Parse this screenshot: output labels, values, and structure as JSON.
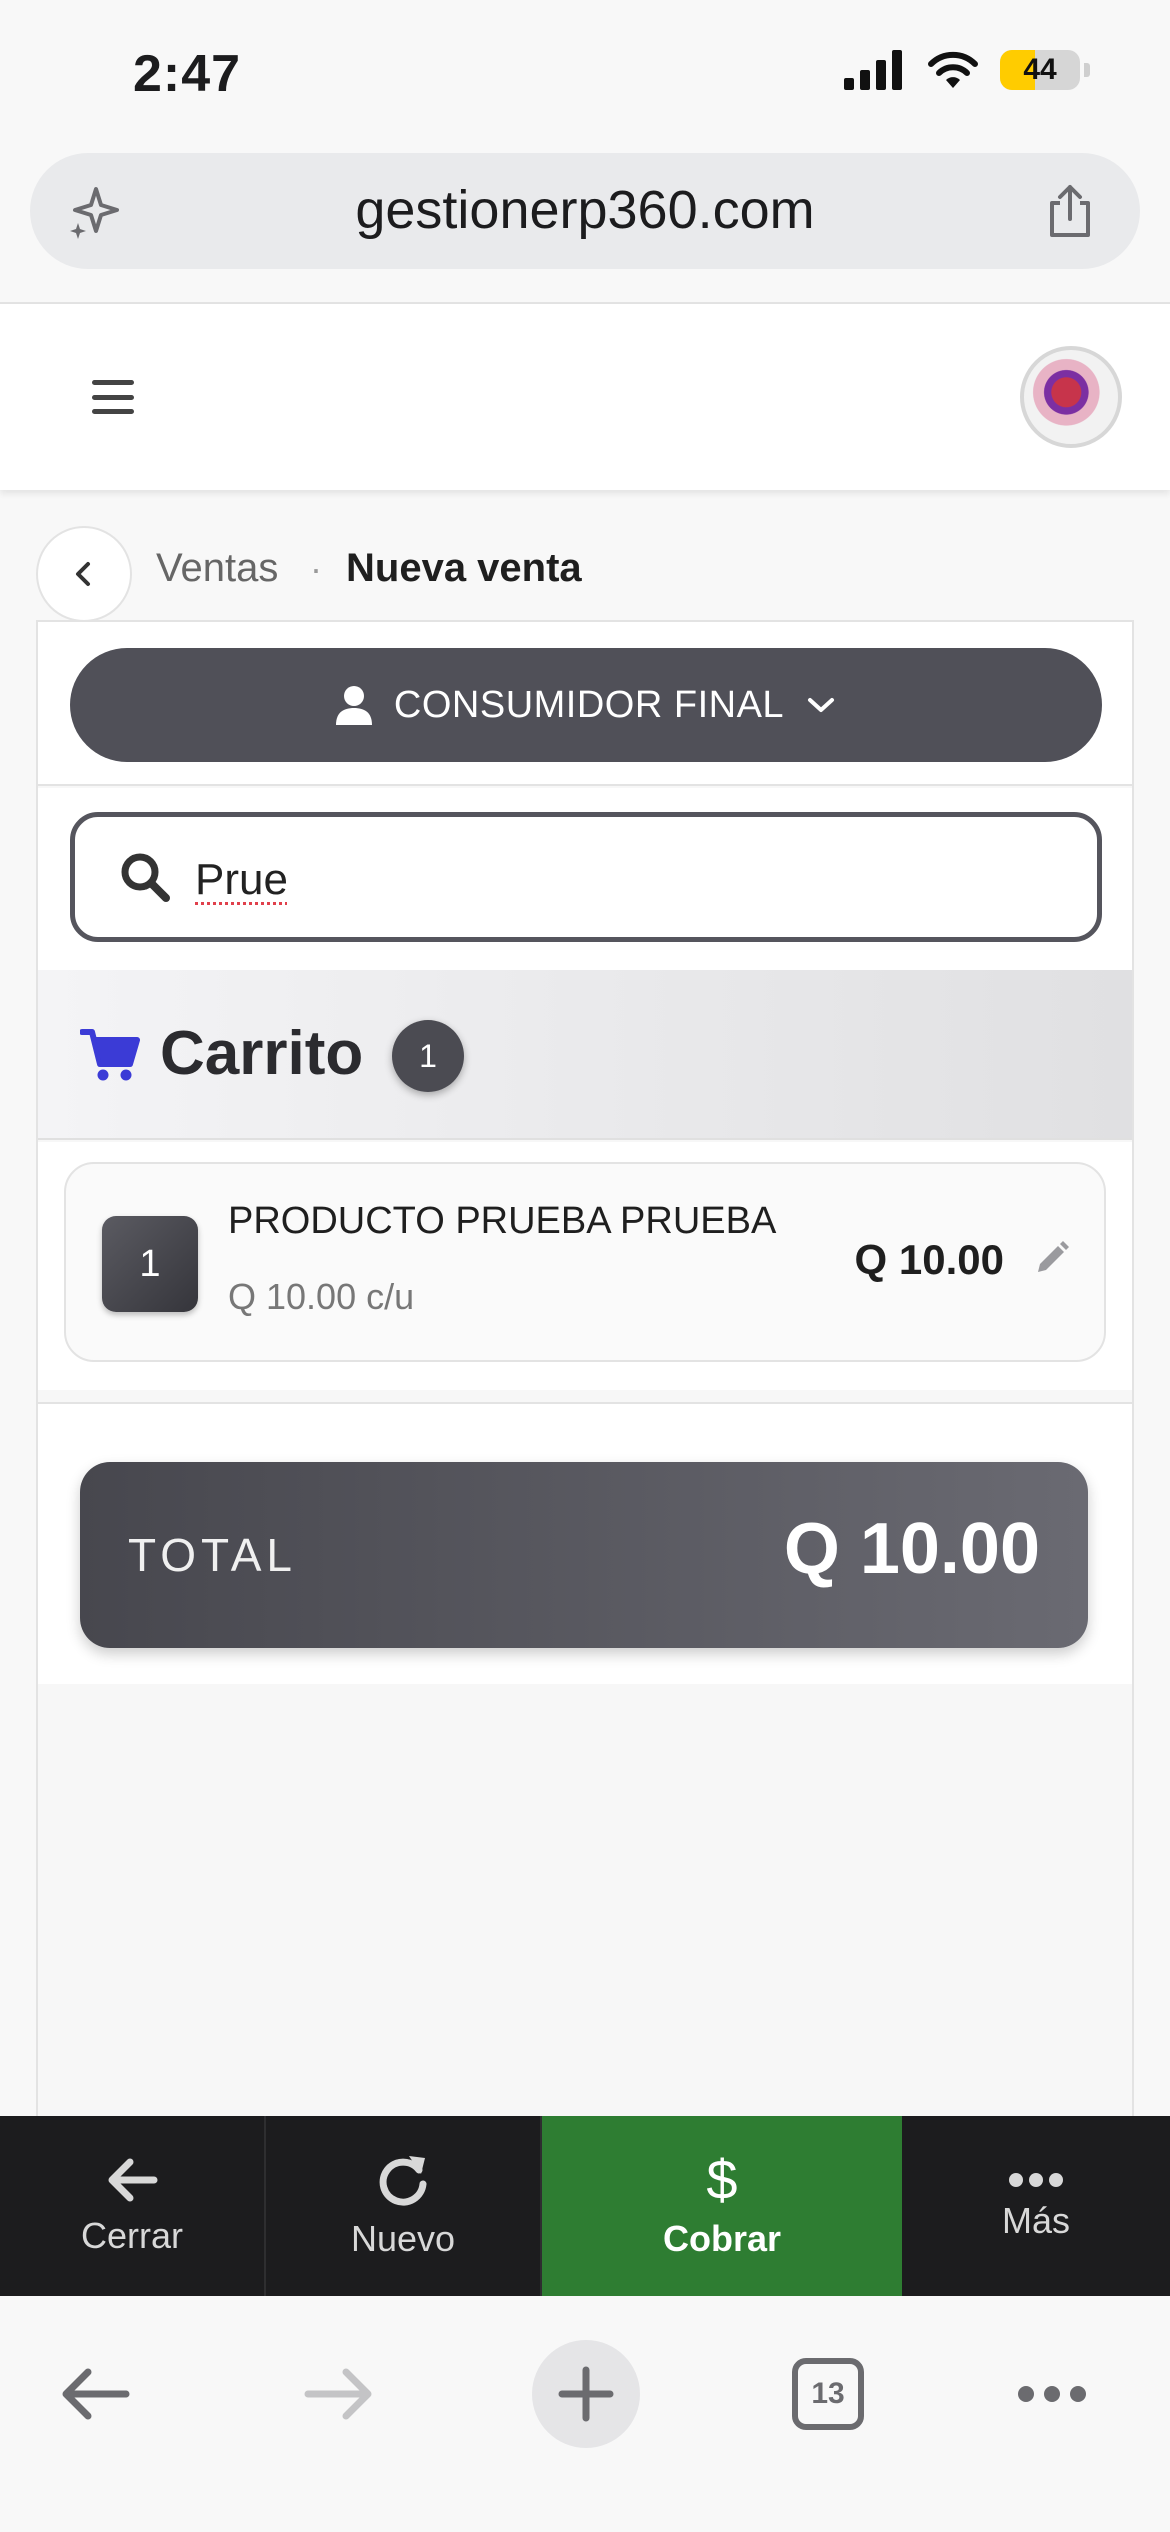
{
  "status_bar": {
    "time": "2:47",
    "battery": "44"
  },
  "browser": {
    "url": "gestionerp360.com",
    "tabs_count": "13"
  },
  "breadcrumb": {
    "parent": "Ventas",
    "separator": "·",
    "current": "Nueva venta"
  },
  "customer": {
    "label": "CONSUMIDOR FINAL"
  },
  "search": {
    "value": "Prue"
  },
  "cart": {
    "title": "Carrito",
    "count": "1",
    "items": [
      {
        "qty": "1",
        "name": "PRODUCTO PRUEBA PRUEBA",
        "unit_price": "Q 10.00 c/u",
        "price": "Q 10.00"
      }
    ]
  },
  "total": {
    "label": "TOTAL",
    "value": "Q 10.00"
  },
  "actions": {
    "cerrar": {
      "label": "Cerrar",
      "icon": "arrow-left-icon"
    },
    "nuevo": {
      "label": "Nuevo",
      "icon": "refresh-icon"
    },
    "cobrar": {
      "label": "Cobrar",
      "icon": "dollar-icon"
    },
    "mas": {
      "label": "Más",
      "icon": "ellipsis-icon"
    }
  },
  "colors": {
    "cobrar": "#2e7d32",
    "cart_icon": "#3b3bd6",
    "dark_button": "#505058"
  }
}
